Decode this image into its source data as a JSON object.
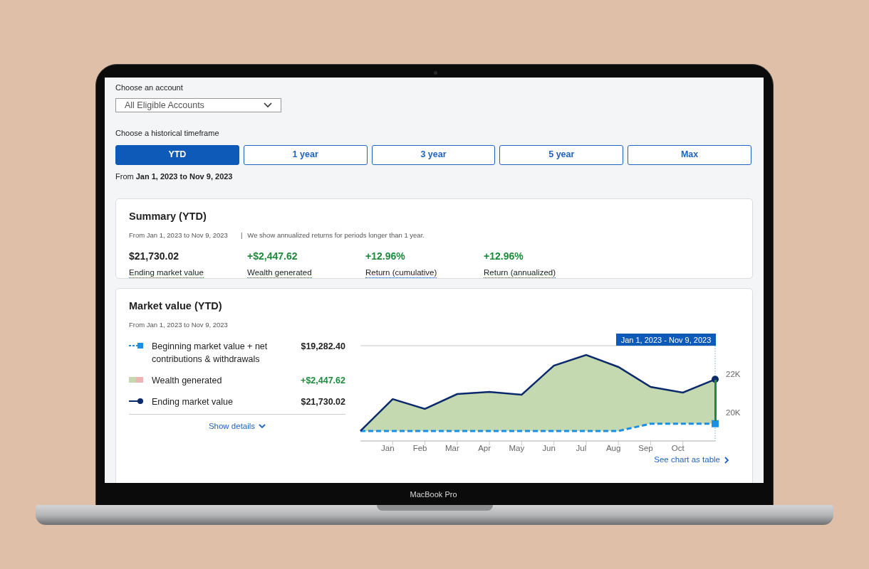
{
  "device": {
    "label": "MacBook Pro"
  },
  "account": {
    "label": "Choose an account",
    "value": "All Eligible Accounts"
  },
  "timeframe": {
    "label": "Choose a historical timeframe",
    "options": [
      {
        "label": "YTD",
        "selected": true
      },
      {
        "label": "1 year",
        "selected": false
      },
      {
        "label": "3 year",
        "selected": false
      },
      {
        "label": "5 year",
        "selected": false
      },
      {
        "label": "Max",
        "selected": false
      }
    ],
    "range": "From **Jan 1, 2023 to Nov 9, 2023**"
  },
  "summary": {
    "title": "Summary (YTD)",
    "range": "From Jan 1, 2023 to Nov 9, 2023",
    "separator": "|",
    "note": "We show annualized returns for periods longer than 1 year.",
    "metrics": [
      {
        "value": "$21,730.02",
        "label": "Ending market value",
        "positive": false
      },
      {
        "value": "+$2,447.62",
        "label": "Wealth generated",
        "positive": true
      },
      {
        "value": "+12.96%",
        "label": "Return (cumulative)",
        "positive": true
      },
      {
        "value": "+12.96%",
        "label": "Return (annualized)",
        "positive": true
      }
    ]
  },
  "market_value": {
    "title": "Market value (YTD)",
    "range": "From Jan 1, 2023 to Nov 9, 2023",
    "legend": [
      {
        "kind": "dashed-square",
        "value": "$19,282.40",
        "positive": false
      },
      {
        "kind": "swatch",
        "label": "Wealth generated",
        "value": "+$2,447.62",
        "positive": true
      },
      {
        "kind": "line-dot",
        "value": "$21,730.02",
        "positive": false
      }
    ],
    "show_details": "Show details",
    "tooltip": "Jan 1, 2023 - Nov 9, 2023",
    "see_table": "See chart as table",
    "chart_data": {
      "type": "line",
      "categories": [
        null,
        "Jan",
        "Feb",
        "Mar",
        "Apr",
        "May",
        "Jun",
        "Jul",
        "Aug",
        "Sep",
        "Oct",
        null
      ],
      "ylim": [
        18500,
        23500
      ],
      "yticks": [
        {
          "value": 20000,
          "label": "20K"
        },
        {
          "value": 22000,
          "label": "22K"
        }
      ],
      "series": [
        {
          "name": "Ending market value",
          "color": "#0b2a6b",
          "line_style": "solid",
          "values": [
            19040,
            20700,
            20190,
            20960,
            21070,
            20930,
            22440,
            23000,
            22370,
            21330,
            21040,
            21730
          ]
        },
        {
          "name": "Beginning market value + net contributions & withdrawals",
          "color": "#1a8fe3",
          "line_style": "dashed",
          "values": [
            19040,
            19040,
            19040,
            19040,
            19040,
            19040,
            19040,
            19040,
            19040,
            19420,
            19420,
            19420
          ]
        }
      ]
    }
  }
}
